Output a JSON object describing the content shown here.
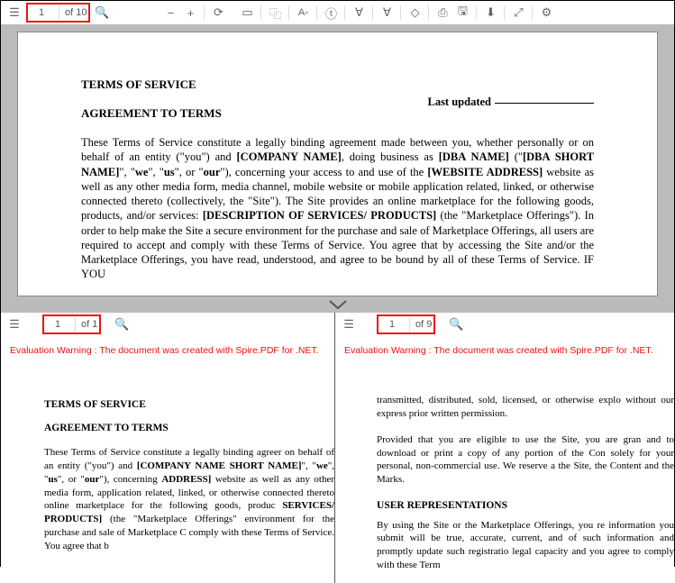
{
  "top": {
    "toolbar": {
      "page_current": "1",
      "page_total": "of 10"
    },
    "doc": {
      "title": "TERMS OF SERVICE",
      "last_updated_label": "Last updated",
      "agreement_heading": "AGREEMENT TO TERMS",
      "para": "These Terms of Service constitute a legally binding agreement made between you, whether personally or on behalf of an entity (\"you\") and [COMPANY NAME], doing business as [DBA NAME] (\"[DBA SHORT NAME]\", \"we\", \"us\", or \"our\"), concerning your access to and use of the [WEBSITE ADDRESS] website as well as any other media form, media channel, mobile website or mobile application related, linked, or otherwise connected thereto (collectively, the \"Site\"). The Site provides an online marketplace for the following goods, products, and/or services: [DESCRIPTION OF SERVICES/ PRODUCTS] (the \"Marketplace Offerings\"). In order to help make the Site a secure environment for the purchase and sale of Marketplace Offerings, all users are required to accept and comply with these Terms of Service. You agree that by accessing the Site and/or the Marketplace Offerings, you have read, understood, and agree to be bound by all of these Terms of Service. IF YOU"
    }
  },
  "bl": {
    "toolbar": {
      "page_current": "1",
      "page_total": "of 1"
    },
    "warning": "Evaluation Warning : The document was created with Spire.PDF for .NET.",
    "doc": {
      "title": "TERMS OF SERVICE",
      "agreement_heading": "AGREEMENT TO TERMS",
      "para": "These Terms of Service constitute a legally binding agreer on behalf of an entity (\"you\") and [COMPANY NAME SHORT NAME]\", \"we\", \"us\", or \"our\"), concerning ADDRESS] website as well as any other media form, application related, linked, or otherwise connected thereto online marketplace for the following goods, produc SERVICES/ PRODUCTS] (the \"Marketplace Offerings\" environment for the purchase and sale of Marketplace C comply with these Terms of Service. You agree that b"
    }
  },
  "br": {
    "toolbar": {
      "page_current": "1",
      "page_total": "of 9"
    },
    "warning": "Evaluation Warning : The document was created with Spire.PDF for .NET.",
    "doc": {
      "p1": "transmitted, distributed, sold, licensed, or otherwise explo without our express prior written permission.",
      "p2": "Provided that you are eligible to use the Site, you are gran and to download or print a copy of any portion of the Con solely for your personal, non-commercial use. We reserve a the Site, the Content and the Marks.",
      "heading": "USER REPRESENTATIONS",
      "p3": " By using the Site or the Marketplace Offerings, you re information you submit will be true, accurate, current, and of such information and promptly update such registratio legal capacity and you agree to comply with these Term"
    }
  }
}
